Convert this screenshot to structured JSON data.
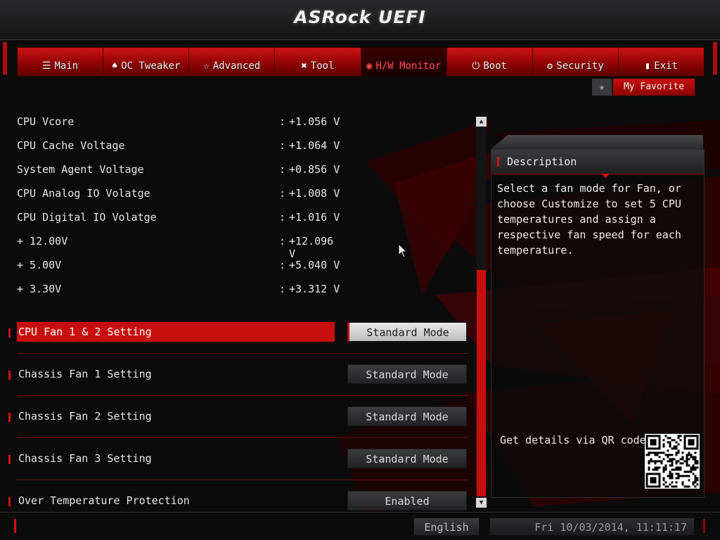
{
  "brand": "ASRock UEFI",
  "nav": {
    "tabs": [
      {
        "label": "Main",
        "icon": "list-icon",
        "glyph": "☰"
      },
      {
        "label": "OC Tweaker",
        "icon": "rocket-icon",
        "glyph": "♠"
      },
      {
        "label": "Advanced",
        "icon": "star-icon",
        "glyph": "☆"
      },
      {
        "label": "Tool",
        "icon": "tools-icon",
        "glyph": "✖"
      },
      {
        "label": "H/W Monitor",
        "icon": "monitor-icon",
        "glyph": "◉"
      },
      {
        "label": "Boot",
        "icon": "power-icon",
        "glyph": "⏻"
      },
      {
        "label": "Security",
        "icon": "shield-icon",
        "glyph": "✪"
      },
      {
        "label": "Exit",
        "icon": "exit-door-icon",
        "glyph": "▮"
      }
    ],
    "active": "H/W Monitor"
  },
  "favorite": {
    "label": "My Favorite",
    "icon": "star-icon"
  },
  "voltages": [
    {
      "label": "CPU Vcore",
      "value": "+1.056 V"
    },
    {
      "label": "CPU Cache Voltage",
      "value": "+1.064 V"
    },
    {
      "label": "System Agent Voltage",
      "value": "+0.856 V"
    },
    {
      "label": "CPU Analog IO Volatge",
      "value": "+1.008 V"
    },
    {
      "label": "CPU Digital IO Volatge",
      "value": "+1.016 V"
    },
    {
      "label": "+ 12.00V",
      "value": "+12.096 V"
    },
    {
      "label": "+ 5.00V",
      "value": "+5.040 V"
    },
    {
      "label": "+ 3.30V",
      "value": "+3.312 V"
    }
  ],
  "settings": [
    {
      "label": "CPU Fan 1 & 2 Setting",
      "value": "Standard Mode",
      "selected": true
    },
    {
      "label": "Chassis Fan 1 Setting",
      "value": "Standard Mode",
      "selected": false
    },
    {
      "label": "Chassis Fan 2 Setting",
      "value": "Standard Mode",
      "selected": false
    },
    {
      "label": "Chassis Fan 3 Setting",
      "value": "Standard Mode",
      "selected": false
    },
    {
      "label": "Over Temperature Protection",
      "value": "Enabled",
      "selected": false
    }
  ],
  "description": {
    "title": "Description",
    "text": "Select a fan mode for Fan, or choose Customize to set 5 CPU temperatures and assign a respective fan speed for each temperature.",
    "qr_label": "Get details via QR code"
  },
  "footer": {
    "language": "English",
    "datetime": "Fri 10/03/2014, 11:11:17"
  },
  "colors": {
    "accent": "#c80f0f",
    "background": "#0b0b0c",
    "text": "#e6e6e6"
  }
}
